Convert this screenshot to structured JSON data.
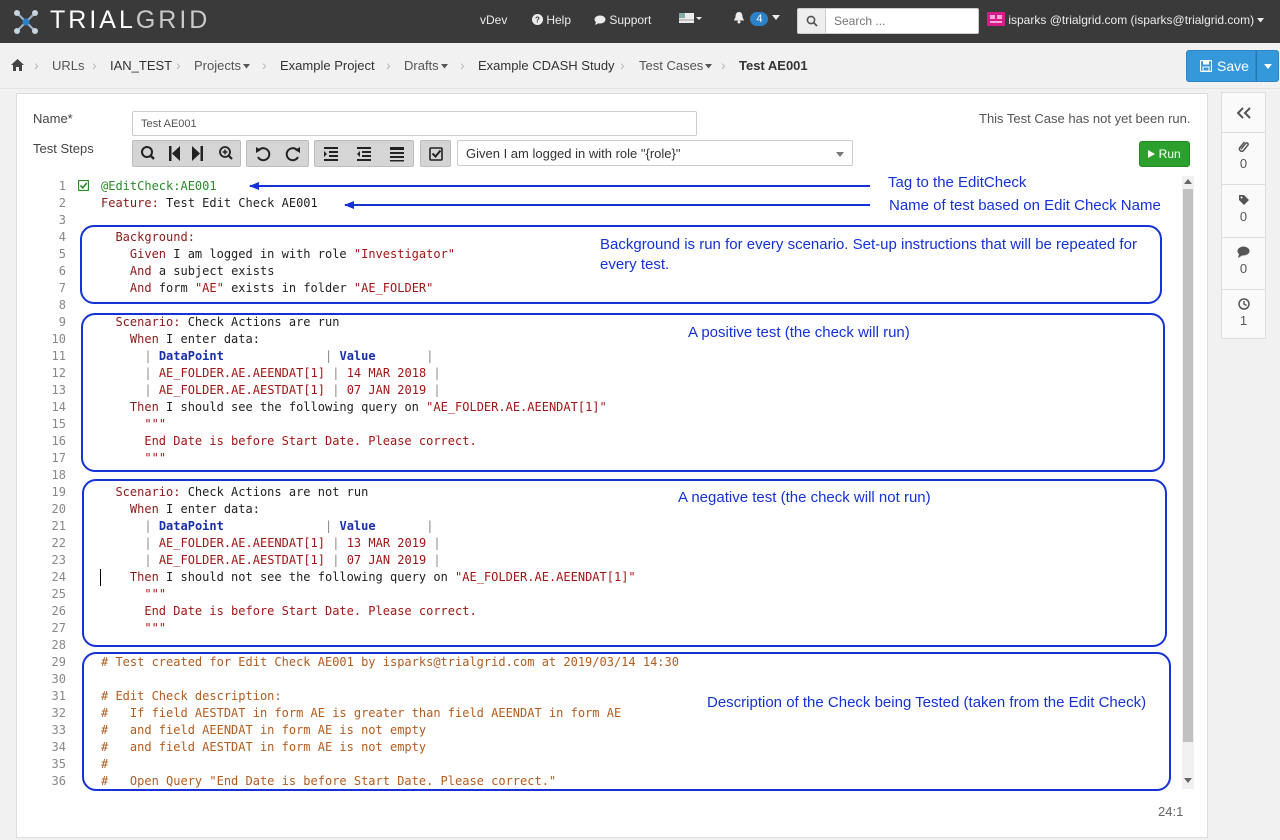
{
  "navbar": {
    "brand_primary": "TRIAL",
    "brand_secondary": "GRID",
    "version": "vDev",
    "help": "Help",
    "support": "Support",
    "notifications_count": "4",
    "search_placeholder": "Search ...",
    "user": "isparks @trialgrid.com (isparks@trialgrid.com)"
  },
  "breadcrumb": {
    "items": [
      {
        "label": "URLs"
      },
      {
        "label": "IAN_TEST"
      },
      {
        "label": "Projects"
      },
      {
        "label": "Example Project"
      },
      {
        "label": "Drafts"
      },
      {
        "label": "Example CDASH Study"
      },
      {
        "label": "Test Cases"
      },
      {
        "label": "Test AE001"
      }
    ]
  },
  "toolbar": {
    "save_label": "Save",
    "run_label": "Run"
  },
  "form": {
    "name_label": "Name*",
    "name_value": "Test AE001",
    "steps_label": "Test Steps",
    "status": "This Test Case has not yet been run.",
    "step_select": "Given I am logged in with role \"{role}\""
  },
  "editor": {
    "cursor": "24:1",
    "lines": [
      {
        "n": "1",
        "t": "@EditCheck:AE001"
      },
      {
        "n": "2",
        "t": "Feature: Test Edit Check AE001"
      },
      {
        "n": "3",
        "t": ""
      },
      {
        "n": "4",
        "t": "  Background:"
      },
      {
        "n": "5",
        "t": "    Given I am logged in with role \"Investigator\""
      },
      {
        "n": "6",
        "t": "    And a subject exists"
      },
      {
        "n": "7",
        "t": "    And form \"AE\" exists in folder \"AE_FOLDER\""
      },
      {
        "n": "8",
        "t": ""
      },
      {
        "n": "9",
        "t": "  Scenario: Check Actions are run"
      },
      {
        "n": "10",
        "t": "    When I enter data:"
      },
      {
        "n": "11",
        "t": "      | DataPoint              | Value       |"
      },
      {
        "n": "12",
        "t": "      | AE_FOLDER.AE.AEENDAT[1] | 14 MAR 2018 |"
      },
      {
        "n": "13",
        "t": "      | AE_FOLDER.AE.AESTDAT[1] | 07 JAN 2019 |"
      },
      {
        "n": "14",
        "t": "    Then I should see the following query on \"AE_FOLDER.AE.AEENDAT[1]\""
      },
      {
        "n": "15",
        "t": "      \"\"\""
      },
      {
        "n": "16",
        "t": "      End Date is before Start Date. Please correct."
      },
      {
        "n": "17",
        "t": "      \"\"\""
      },
      {
        "n": "18",
        "t": ""
      },
      {
        "n": "19",
        "t": "  Scenario: Check Actions are not run"
      },
      {
        "n": "20",
        "t": "    When I enter data:"
      },
      {
        "n": "21",
        "t": "      | DataPoint              | Value       |"
      },
      {
        "n": "22",
        "t": "      | AE_FOLDER.AE.AEENDAT[1] | 13 MAR 2019 |"
      },
      {
        "n": "23",
        "t": "      | AE_FOLDER.AE.AESTDAT[1] | 07 JAN 2019 |"
      },
      {
        "n": "24",
        "t": "    Then I should not see the following query on \"AE_FOLDER.AE.AEENDAT[1]\""
      },
      {
        "n": "25",
        "t": "      \"\"\""
      },
      {
        "n": "26",
        "t": "      End Date is before Start Date. Please correct."
      },
      {
        "n": "27",
        "t": "      \"\"\""
      },
      {
        "n": "28",
        "t": ""
      },
      {
        "n": "29",
        "t": "# Test created for Edit Check AE001 by isparks@trialgrid.com at 2019/03/14 14:30"
      },
      {
        "n": "30",
        "t": ""
      },
      {
        "n": "31",
        "t": "# Edit Check description:"
      },
      {
        "n": "32",
        "t": "#   If field AESTDAT in form AE is greater than field AEENDAT in form AE"
      },
      {
        "n": "33",
        "t": "#   and field AEENDAT in form AE is not empty"
      },
      {
        "n": "34",
        "t": "#   and field AESTDAT in form AE is not empty"
      },
      {
        "n": "35",
        "t": "#"
      },
      {
        "n": "36",
        "t": "#   Open Query \"End Date is before Start Date. Please correct.\""
      }
    ]
  },
  "annotations": {
    "tag": "Tag to the EditCheck",
    "name": "Name of test based on Edit Check Name",
    "background": "Background is run for every scenario. Set-up instructions that will be repeated for every test.",
    "positive": "A positive test (the check will run)",
    "negative": "A negative test (the check will not run)",
    "description": "Description of the Check being Tested (taken from the Edit Check)"
  },
  "sidebar": {
    "counts": [
      "0",
      "0",
      "0",
      "1"
    ]
  },
  "colors": {
    "navbar": "#3a3a3a",
    "accent": "#3498db",
    "run": "#2ca02c",
    "annotation": "#1432d6"
  }
}
